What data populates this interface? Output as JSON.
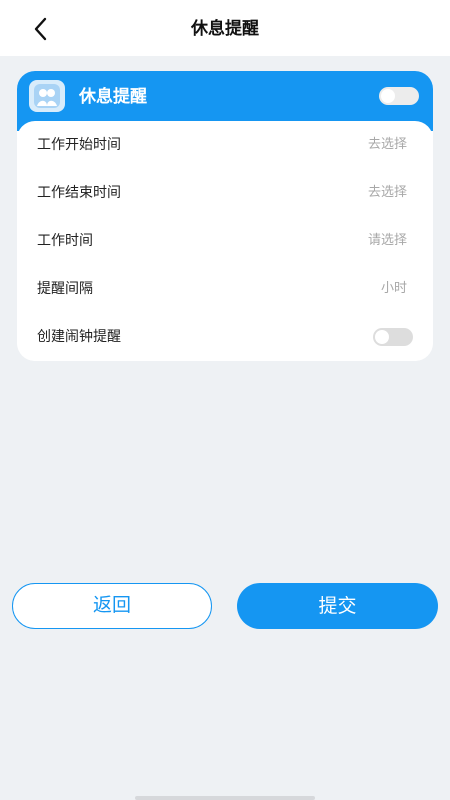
{
  "header": {
    "title": "休息提醒",
    "back_icon": "chevron-left-icon"
  },
  "card": {
    "title": "休息提醒",
    "icon": "reminder-app-icon",
    "toggle_on": false,
    "accent_color": "#1596f2",
    "rows": [
      {
        "label": "工作开始时间",
        "value": "去选择"
      },
      {
        "label": "工作结束时间",
        "value": "去选择"
      },
      {
        "label": "工作时间",
        "value": "请选择"
      },
      {
        "label": "提醒间隔",
        "value": "小时"
      }
    ],
    "alarm": {
      "label": "创建闹钟提醒",
      "toggle_on": false
    }
  },
  "actions": {
    "back_label": "返回",
    "submit_label": "提交"
  }
}
